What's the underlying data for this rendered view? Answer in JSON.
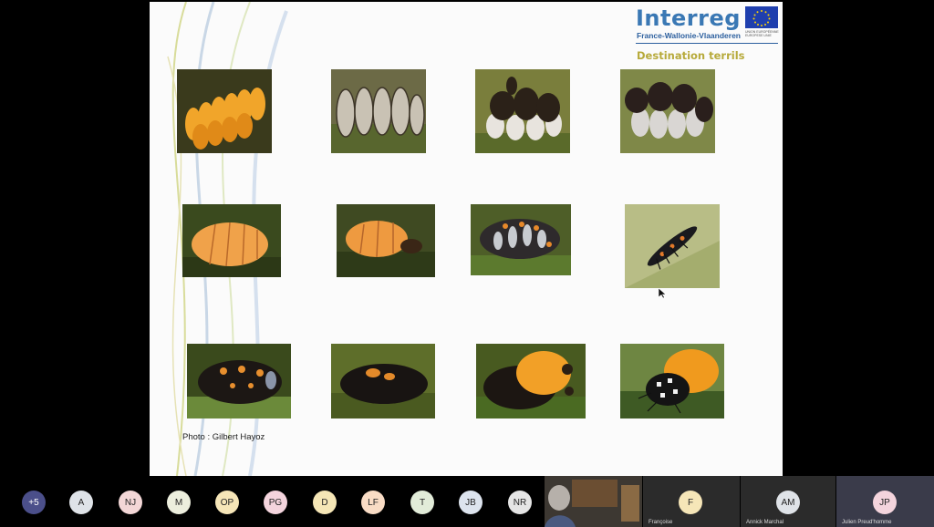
{
  "slide": {
    "brand_name": "Interreg",
    "brand_sub": "France-Wallonie-Vlaanderen",
    "eu_text": "UNION EUROPÉENNE EUROPESE UNIE",
    "subtitle": "Destination terrils",
    "credit": "Photo : Gilbert Hayoz",
    "photos": [
      {
        "name": "photo-eggs-yellow",
        "scene": "eggs-yellow"
      },
      {
        "name": "photo-eggs-hatching",
        "scene": "eggs-grey"
      },
      {
        "name": "photo-larvae-emerging-1",
        "scene": "emerging"
      },
      {
        "name": "photo-larvae-emerging-2",
        "scene": "emerging"
      },
      {
        "name": "photo-prepupa-1",
        "scene": "pupa-orange"
      },
      {
        "name": "photo-prepupa-2",
        "scene": "pupa-orange"
      },
      {
        "name": "photo-pupa-spotted",
        "scene": "pupa-spotted"
      },
      {
        "name": "photo-larva-on-leaf",
        "scene": "larva"
      },
      {
        "name": "photo-pupa-dark",
        "scene": "pupa-dark"
      },
      {
        "name": "photo-pupa-splitting",
        "scene": "pupa-dark"
      },
      {
        "name": "photo-adult-emerging",
        "scene": "adult-emerging"
      },
      {
        "name": "photo-adult-ladybird",
        "scene": "adult"
      }
    ]
  },
  "participants": [
    {
      "initials": "+5",
      "color": "#4b4f8a"
    },
    {
      "initials": "A",
      "color": "#dfe3e8"
    },
    {
      "initials": "NJ",
      "color": "#f3d7d7"
    },
    {
      "initials": "M",
      "color": "#eceedd"
    },
    {
      "initials": "OP",
      "color": "#f6e6b8"
    },
    {
      "initials": "PG",
      "color": "#f4d4dd"
    },
    {
      "initials": "D",
      "color": "#f5e6b6"
    },
    {
      "initials": "LF",
      "color": "#f9dcc5"
    },
    {
      "initials": "T",
      "color": "#e2ecd9"
    },
    {
      "initials": "JB",
      "color": "#dde4ee"
    },
    {
      "initials": "NR",
      "color": "#e5e5e5"
    }
  ],
  "tiles": [
    {
      "initials": "F",
      "name": "Françoise",
      "color": "#f6e6b8"
    },
    {
      "initials": "AM",
      "name": "Annick Marchal",
      "color": "#dfe3e8"
    },
    {
      "initials": "JP",
      "name": "Julien Preud'homme",
      "color": "#f4d4dd"
    }
  ]
}
